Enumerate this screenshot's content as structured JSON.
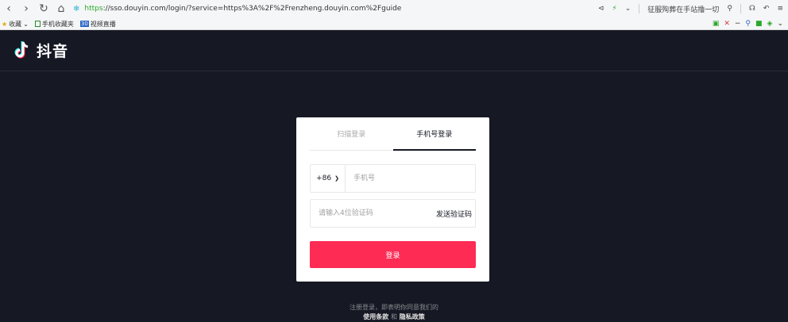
{
  "browser": {
    "url_secure": "https",
    "url_rest": "://sso.douyin.com/login/?service=https%3A%2F%2Frenzheng.douyin.com%2Fguide",
    "right_hint": "征服殉葬在手站撸一切",
    "bookmarks": [
      {
        "label": "收藏",
        "type": "star"
      },
      {
        "label": "手机收藏夹",
        "type": "box"
      },
      {
        "label": "视频直播",
        "type": "tag",
        "tag": "30"
      }
    ]
  },
  "header": {
    "logo_text": "抖音"
  },
  "login": {
    "tabs": [
      {
        "label": "扫描登录",
        "active": false
      },
      {
        "label": "手机号登录",
        "active": true
      }
    ],
    "country_code": "+86",
    "phone_placeholder": "手机号",
    "code_placeholder": "请输入4位验证码",
    "send_code_label": "发送验证码",
    "submit_label": "登录"
  },
  "agreement": {
    "line1": "注册登录，即表明你同意我们的",
    "terms": "使用条款",
    "and": "和",
    "privacy": "隐私政策"
  },
  "colors": {
    "accent": "#fe2c55",
    "background": "#161823"
  }
}
